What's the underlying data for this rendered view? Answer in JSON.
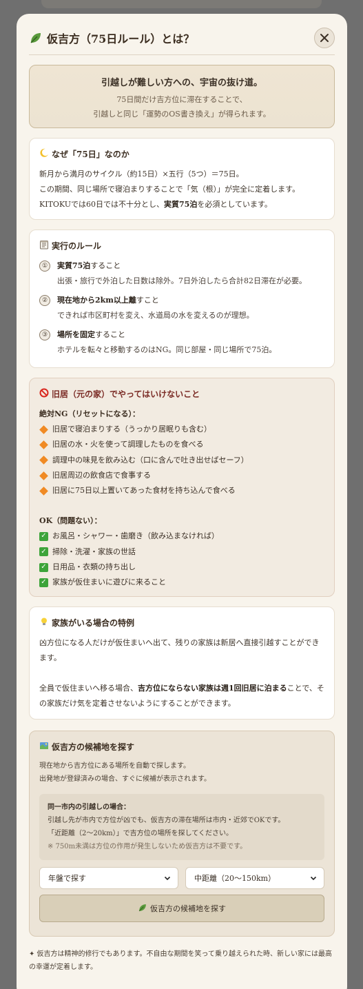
{
  "modal": {
    "title": "仮吉方（75日ルール）とは？",
    "close_icon": "close-icon"
  },
  "hero": {
    "title": "引越しが難しい方への、宇宙の抜け道。",
    "line1": "75日間だけ吉方位に滞在することで、",
    "line2": "引越しと同じ「運勢のOS書き換え」が得られます。"
  },
  "why": {
    "icon": "crescent-moon-icon",
    "title": "なぜ「75日」なのか",
    "line1": "新月から満月のサイクル（約15日）×五行（5つ）＝75日。",
    "line2": "この期間、同じ場所で寝泊まりすることで「気（根）」が完全に定着します。",
    "line3_pre": "KITOKUでは60日では不十分とし、",
    "line3_bold": "実質75泊",
    "line3_post": "を必須としています。"
  },
  "rules": {
    "icon": "notepad-icon",
    "title": "実行のルール",
    "items": [
      {
        "num": "①",
        "bold": "実質75泊",
        "rest": "すること",
        "desc": "出張・旅行で外泊した日数は除外。7日外泊したら合計82日滞在が必要。"
      },
      {
        "num": "②",
        "bold": "現在地から2km以上離",
        "rest": "すこと",
        "desc": "できれば市区町村を変え、水道局の水を変えるのが理想。"
      },
      {
        "num": "③",
        "bold": "場所を固定",
        "rest": "すること",
        "desc": "ホテルを転々と移動するのはNG。同じ部屋・同じ場所で75泊。"
      }
    ]
  },
  "ng": {
    "icon": "prohibited-icon",
    "title": "旧居（元の家）でやってはいけないこと",
    "ng_label": "絶対NG（リセットになる）：",
    "ng_items": [
      "旧居で寝泊まりする（うっかり居眠りも含む）",
      "旧居の水・火を使って調理したものを食べる",
      "調理中の味見を飲み込む（口に含んで吐き出せばセーフ）",
      "旧居周辺の飲食店で食事する",
      "旧居に75日以上置いてあった食材を持ち込んで食べる"
    ],
    "ok_label": "OK（問題ない）：",
    "ok_items": [
      "お風呂・シャワー・歯磨き（飲み込まなければ）",
      "掃除・洗濯・家族の世話",
      "日用品・衣類の持ち出し",
      "家族が仮住まいに遊びに来ること"
    ]
  },
  "family": {
    "icon": "lightbulb-icon",
    "title": "家族がいる場合の特例",
    "para1": "凶方位になる人だけが仮住まいへ出て、残りの家族は新居へ直接引越すことができます。",
    "para2_pre": "全員で仮住まいへ移る場合、",
    "para2_bold": "吉方位にならない家族は週1回旧居に泊まる",
    "para2_post": "ことで、その家族だけ気を定着させないようにすることができます。"
  },
  "search": {
    "icon": "map-icon",
    "title": "仮吉方の候補地を探す",
    "line1": "現在地から吉方位にある場所を自動で探します。",
    "line2": "出発地が登録済みの場合、すぐに候補が表示されます。",
    "info_label": "同一市内の引越しの場合：",
    "info_line1": "引越し先が市内で方位が凶でも、仮吉方の滞在場所は市内・近郊でOKです。",
    "info_line2": "「近距離（2〜20km）」で吉方位の場所を探してください。",
    "info_note": "※ 750m未満は方位の作用が発生しないため仮吉方は不要です。",
    "select1": "年盤で探す",
    "select2": "中距離（20〜150km）",
    "button": "仮吉方の候補地を探す"
  },
  "footnote": "✦ 仮吉方は精神的修行でもあります。不自由な期間を笑って乗り越えられた時、新しい家には最高の幸運が定着します。",
  "colors": {
    "accent": "#7a2a24",
    "diamond": "#f08a24",
    "check": "#3da43a",
    "leaf": "#4f8a3a"
  }
}
